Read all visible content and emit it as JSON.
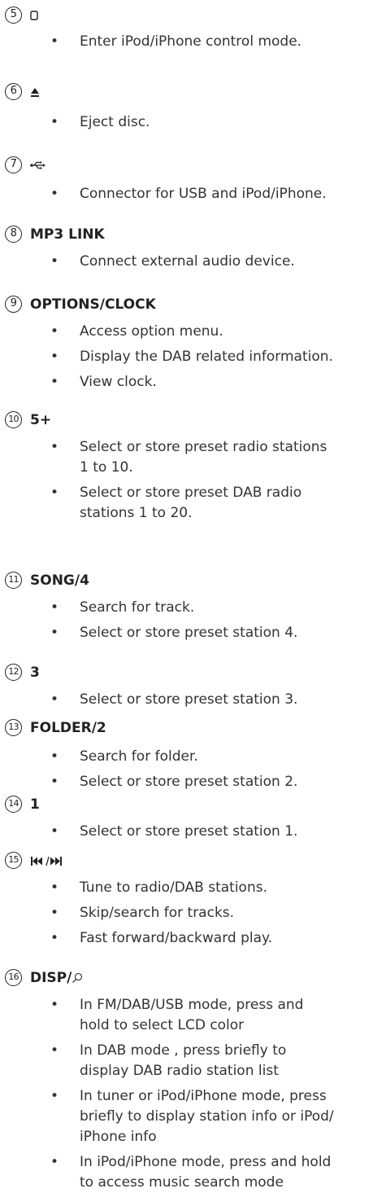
{
  "items": [
    {
      "number": "5",
      "heading": "",
      "icon": "ipod-icon",
      "bullets": [
        [
          "Enter iPod/iPhone control mode."
        ]
      ]
    },
    {
      "number": "6",
      "heading": "",
      "icon": "eject-icon",
      "bullets": [
        [
          "Eject disc."
        ]
      ]
    },
    {
      "number": "7",
      "heading": "",
      "icon": "usb-icon",
      "bullets": [
        [
          "Connector for USB and iPod/iPhone."
        ]
      ]
    },
    {
      "number": "8",
      "heading": "MP3 LINK",
      "icon": "",
      "bullets": [
        [
          "Connect external audio device."
        ]
      ]
    },
    {
      "number": "9",
      "heading": "OPTIONS/CLOCK",
      "icon": "",
      "bullets": [
        [
          "Access option menu."
        ],
        [
          "Display the DAB related information."
        ],
        [
          "View clock."
        ]
      ]
    },
    {
      "number": "10",
      "heading": "5+",
      "icon": "",
      "bullets": [
        [
          "Select or store preset radio stations",
          "1 to 10."
        ],
        [
          "Select or store preset DAB radio",
          "stations 1 to 20."
        ]
      ]
    },
    {
      "number": "11",
      "heading": "SONG/4",
      "icon": "",
      "bullets": [
        [
          "Search for track."
        ],
        [
          "Select or store preset station 4."
        ]
      ]
    },
    {
      "number": "12",
      "heading": "3",
      "icon": "",
      "bullets": [
        [
          "Select or store preset station 3."
        ]
      ]
    },
    {
      "number": "13",
      "heading": "FOLDER/2",
      "icon": "",
      "bullets": [
        [
          "Search for folder."
        ],
        [
          "Select or store preset station 2."
        ]
      ]
    },
    {
      "number": "14",
      "heading": "1",
      "icon": "",
      "bullets": [
        [
          "Select or store preset station 1."
        ]
      ]
    },
    {
      "number": "15",
      "heading": "",
      "icon": "prev-next-icon",
      "bullets": [
        [
          "Tune to radio/DAB stations."
        ],
        [
          "Skip/search for tracks."
        ],
        [
          "Fast forward/backward play."
        ]
      ]
    },
    {
      "number": "16",
      "heading": "DISP/",
      "icon": "search-icon",
      "bullets": [
        [
          "In FM/DAB/USB mode, press and",
          "hold to select LCD color"
        ],
        [
          "In DAB mode , press briefly to",
          "display DAB radio station list"
        ],
        [
          "In tuner or iPod/iPhone mode, press",
          "briefly to display station info or iPod/",
          "iPhone info"
        ],
        [
          "In iPod/iPhone mode, press and hold",
          "to access music search mode"
        ]
      ]
    }
  ]
}
